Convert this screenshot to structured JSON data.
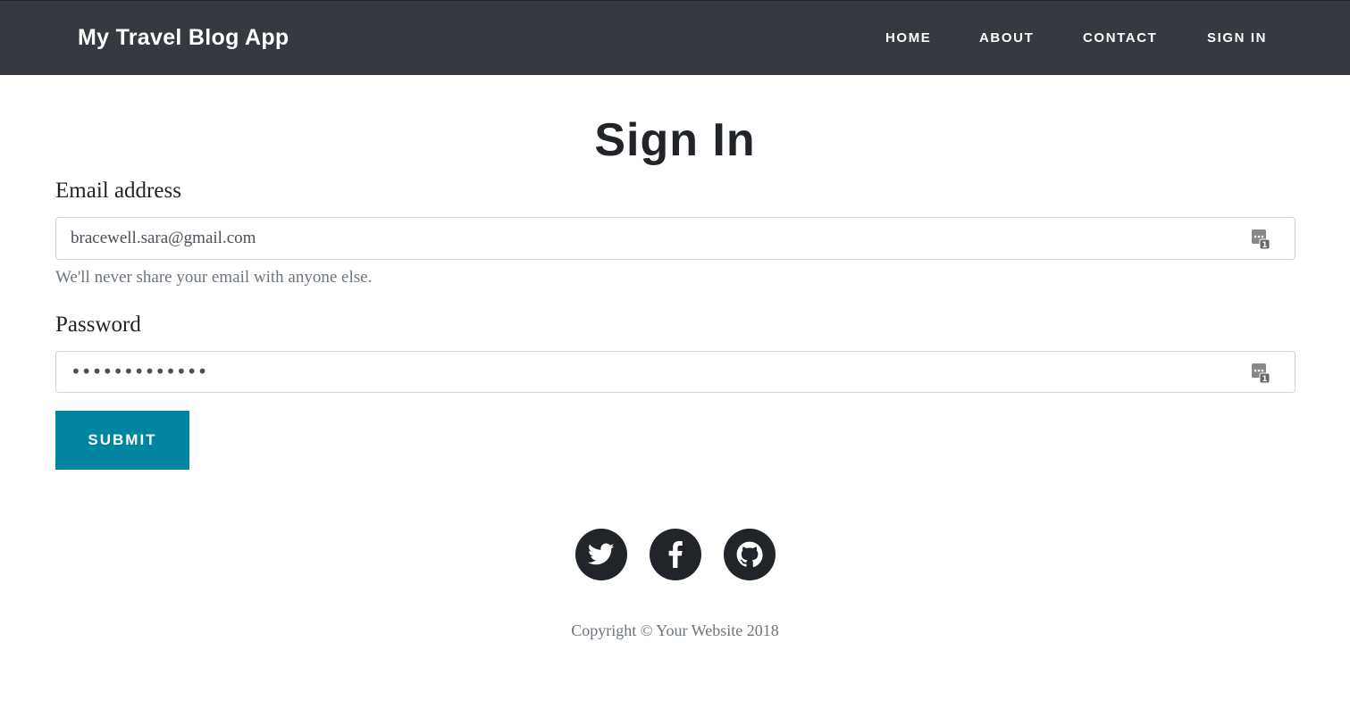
{
  "navbar": {
    "brand": "My Travel Blog App",
    "links": [
      {
        "label": "HOME"
      },
      {
        "label": "ABOUT"
      },
      {
        "label": "CONTACT"
      },
      {
        "label": "SIGN IN"
      }
    ]
  },
  "page": {
    "title": "Sign In"
  },
  "form": {
    "email": {
      "label": "Email address",
      "value": "bracewell.sara@gmail.com",
      "help": "We'll never share your email with anyone else."
    },
    "password": {
      "label": "Password",
      "masked_value": "•••••••••••••"
    },
    "submit_label": "SUBMIT"
  },
  "footer": {
    "social": [
      {
        "icon": "twitter-icon"
      },
      {
        "icon": "facebook-icon"
      },
      {
        "icon": "github-icon"
      }
    ],
    "copyright": "Copyright © Your Website 2018"
  },
  "colors": {
    "navbar_bg": "#343a40",
    "accent": "#0085a1",
    "social_bg": "#212529"
  }
}
